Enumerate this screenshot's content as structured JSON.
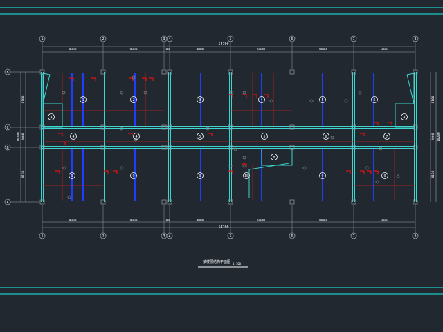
{
  "drawing": {
    "title_line1": "某楼层结构平面图",
    "title_line2": "1:100",
    "colors": {
      "background": "#212830",
      "frame": "#1fc7c7",
      "wall": "#3dd6d0",
      "dim": "#9aa3ab",
      "text": "#ffffff",
      "beam_blue": "#1f3dff",
      "beam_red": "#c0201e",
      "rebar_red": "#e01010",
      "column": "#8a8f96"
    },
    "top_axes": [
      "1",
      "2",
      "3",
      "4",
      "5",
      "6",
      "7",
      "8"
    ],
    "bottom_axes": [
      "1",
      "2",
      "3",
      "4",
      "5",
      "6",
      "7",
      "8"
    ],
    "left_axes": [
      "B",
      "C",
      "B",
      "A"
    ],
    "top_dims": [
      "9000",
      "9000",
      "700",
      "9000",
      "9000",
      "9000",
      "9000"
    ],
    "top_total": "54700",
    "bottom_dims": [
      "9000",
      "9000",
      "700",
      "9000",
      "9000",
      "9000",
      "9000"
    ],
    "bottom_total": "54700",
    "left_dims": [
      "8100",
      "2000",
      "8100"
    ],
    "left_total": "18200",
    "right_dims": [
      "8100",
      "2000",
      "8100"
    ],
    "right_total": "18200",
    "rooms_top": [
      "1",
      "2",
      "3",
      "4",
      "5",
      "6",
      "7",
      "8"
    ],
    "rooms_mid": [
      "4",
      "4",
      "5",
      "5",
      "6",
      "7",
      "8"
    ],
    "rooms_bottom": [
      "9",
      "9",
      "9",
      "10",
      "9",
      "9",
      "11"
    ],
    "corner_labels": [
      "4",
      "4"
    ],
    "stair_label": "8"
  }
}
